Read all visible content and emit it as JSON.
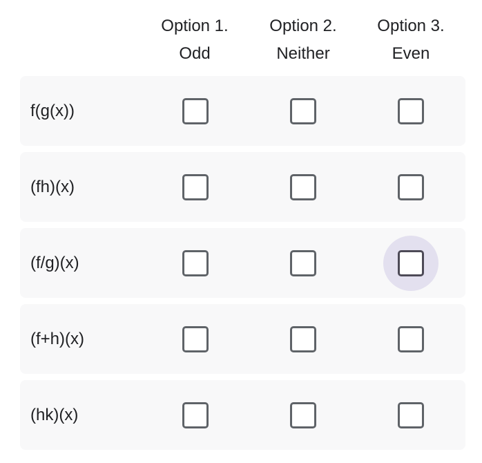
{
  "columns": [
    {
      "line1": "Option 1.",
      "line2": "Odd"
    },
    {
      "line1": "Option 2.",
      "line2": "Neither"
    },
    {
      "line1": "Option 3.",
      "line2": "Even"
    }
  ],
  "rows": [
    {
      "label": "f(g(x))",
      "checked": [
        false,
        false,
        false
      ]
    },
    {
      "label": "(fh)(x)",
      "checked": [
        false,
        false,
        false
      ]
    },
    {
      "label": "(f/g)(x)",
      "checked": [
        false,
        false,
        false
      ],
      "focused_column": 3
    },
    {
      "label": "(f+h)(x)",
      "checked": [
        false,
        false,
        false
      ]
    },
    {
      "label": "(hk)(x)",
      "checked": [
        false,
        false,
        false
      ]
    }
  ],
  "colors": {
    "row_background": "#f8f8f9",
    "focus_halo": "#e3e0ef",
    "checkbox_border": "#5f6368"
  }
}
